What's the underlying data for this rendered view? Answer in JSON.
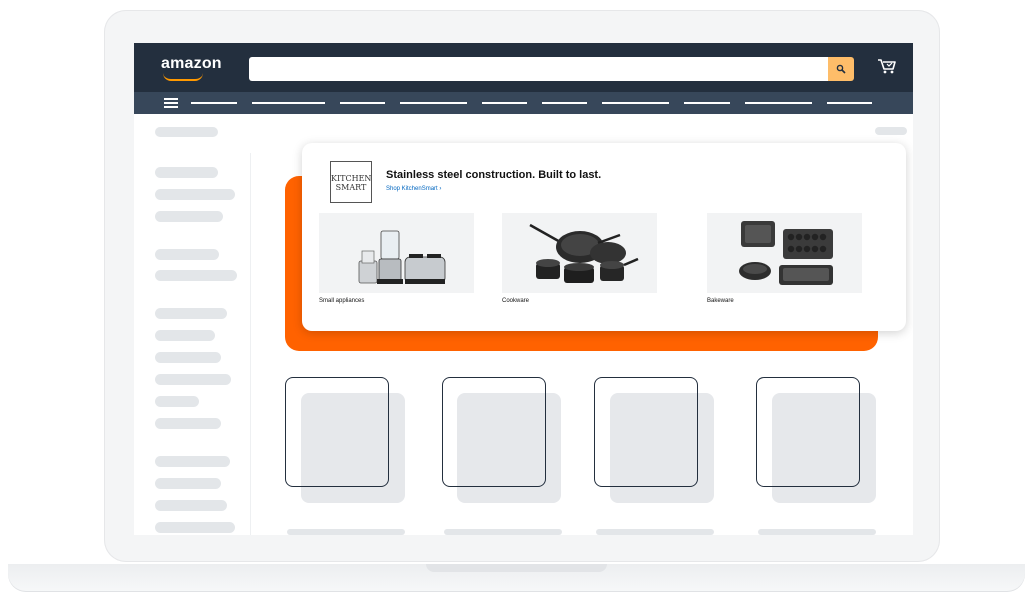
{
  "header": {
    "logo_text": "amazon",
    "search": {
      "placeholder": "",
      "value": ""
    },
    "search_icon": "search-icon",
    "cart_icon": "cart-icon"
  },
  "nav": {
    "menu_icon": "hamburger-icon"
  },
  "promo": {
    "brand_logo": "KITCHEN SMART",
    "headline": "Stainless steel construction. Built to last.",
    "link": "Shop KitchenSmart ›",
    "tiles": [
      {
        "label": "Small appliances",
        "image": "small-appliances-image"
      },
      {
        "label": "Cookware",
        "image": "cookware-image"
      },
      {
        "label": "Bakeware",
        "image": "bakeware-image"
      }
    ]
  },
  "colors": {
    "header_bg": "#232f3e",
    "nav_bg": "#37475a",
    "search_button": "#febd69",
    "promo_accent": "#ff6200",
    "link": "#0066c0"
  }
}
